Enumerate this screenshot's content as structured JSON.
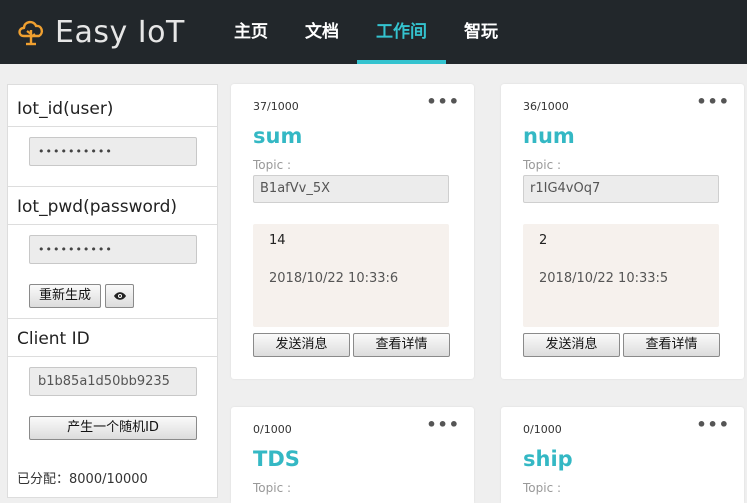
{
  "header": {
    "logo_text": "Easy IoT",
    "nav": [
      {
        "label": "主页"
      },
      {
        "label": "文档"
      },
      {
        "label": "工作间",
        "active": true
      },
      {
        "label": "智玩"
      }
    ],
    "accent_color": "#34c3cf",
    "logo_color": "#f0a030"
  },
  "sidebar": {
    "iot_id_label": "Iot_id(user)",
    "iot_id_value": "••••••••••",
    "iot_pwd_label": "Iot_pwd(password)",
    "iot_pwd_value": "••••••••••",
    "regenerate_label": "重新生成",
    "eye_icon": "eye-icon",
    "client_id_label": "Client ID",
    "client_id_value": "b1b85a1d50bb9235",
    "random_id_label": "产生一个随机ID",
    "allocated_text": "已分配：8000/10000"
  },
  "cards": [
    {
      "count": "37/1000",
      "name": "sum",
      "topic_label": "Topic :",
      "topic": "B1afVv_5X",
      "value": "14",
      "time": "2018/10/22 10:33:6",
      "send_label": "发送消息",
      "detail_label": "查看详情"
    },
    {
      "count": "36/1000",
      "name": "num",
      "topic_label": "Topic :",
      "topic": "r1IG4vOq7",
      "value": "2",
      "time": "2018/10/22 10:33:5",
      "send_label": "发送消息",
      "detail_label": "查看详情"
    },
    {
      "count": "0/1000",
      "name": "TDS",
      "topic_label": "Topic :"
    },
    {
      "count": "0/1000",
      "name": "ship",
      "topic_label": "Topic :"
    }
  ],
  "more_icon": "•••"
}
